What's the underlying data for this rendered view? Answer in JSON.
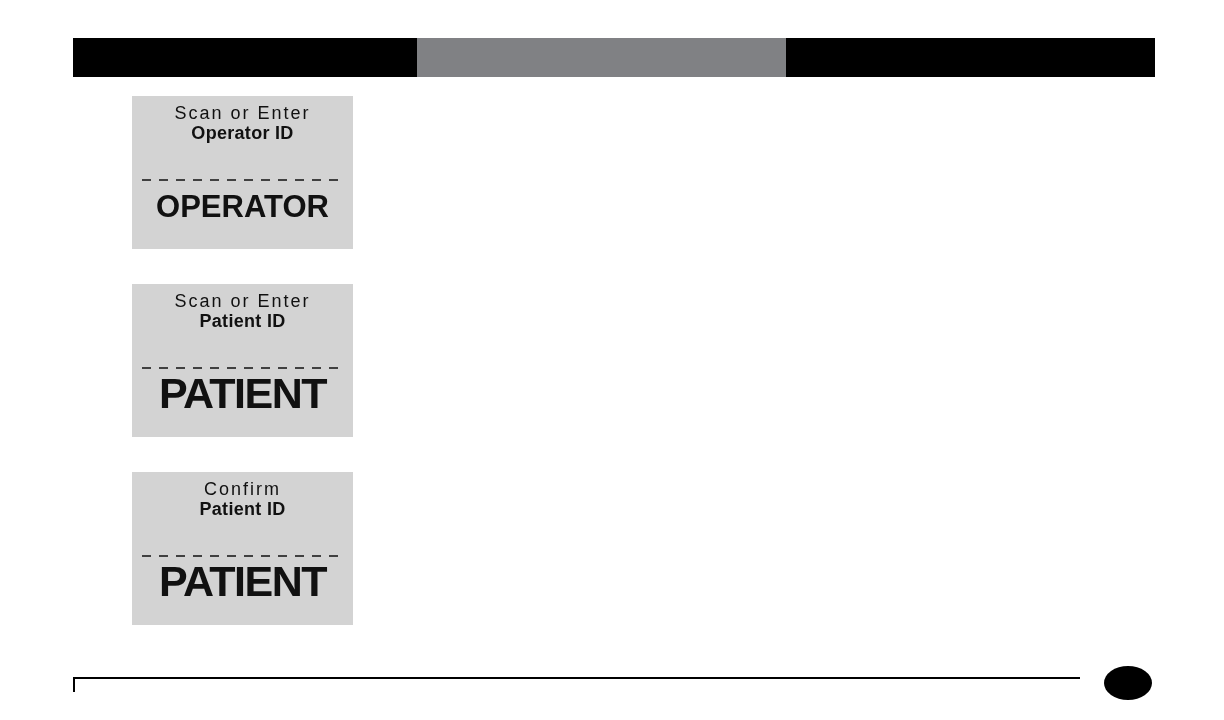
{
  "header_bar": {
    "segments": [
      {
        "selected": false
      },
      {
        "selected": true
      },
      {
        "selected": false
      }
    ]
  },
  "screens": [
    {
      "prompt": "Scan or Enter",
      "field": "Operator ID",
      "entry": "OPERATOR"
    },
    {
      "prompt": "Scan or Enter",
      "field": "Patient ID",
      "entry": "PATIENT"
    },
    {
      "prompt": "Confirm",
      "field": "Patient ID",
      "entry": "PATIENT"
    }
  ]
}
